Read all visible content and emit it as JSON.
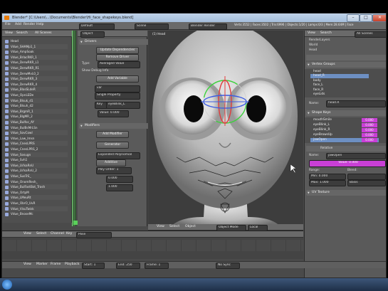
{
  "window": {
    "title": "Blender* [C:\\Users\\...\\Documents\\Blender\\Hi_face_shapekeys.blend]"
  },
  "top_menu": {
    "items": [
      "File",
      "Add",
      "Render",
      "Help"
    ],
    "layout": "Default",
    "scene": "Scene",
    "engine": "Blender Render"
  },
  "info_text": "Verts:3552 | Faces:3502 | Tris:6996 | Objects:1/20 | Lamps:0/3 | Mem:28.64M | Face",
  "outliner": {
    "header": [
      "View",
      "Search",
      "All Scenes"
    ],
    "rows": [
      "Head",
      "Vdue_SHAMp1_1",
      "Vdue_AmpSoak",
      "Vdue_BrlacRKR_1",
      "Vdue_DerwRKR_L1",
      "Vdue_DerwRKR_R1",
      "Vdue_DerwMvL0_2",
      "Vdue_DerwRKR_3",
      "Vdue_DerwRKR_4",
      "Vdue_BlasSLdeR",
      "Vdue_OpnLEDe",
      "Vdue_Blsuk_d1",
      "Vdue_Blsuh_d2",
      "Vdue_BrgmR_1",
      "Vdue_BlgMR_2",
      "Vdue_Bulfoc_AY",
      "Vdue_BulBsMrLSn",
      "Vdue_SovCowl",
      "Vdue_Law_Imsn",
      "Vdue_CnesLPRS",
      "Vdue_CnesLPRS_2",
      "Vdue_Sosugn",
      "Vdue_Svh1",
      "Vdue_LVIsaRnU",
      "Vdue_LVIsaRnU_2",
      "Vdue_SusTrE_",
      "Vdue_OnomResh_",
      "Vdue_BulFastBot_Trash",
      "Vdue_OrtpM",
      "Vdue_LMeuRt",
      "Vdue_ObrO_UvR",
      "Vdue_VisuTwisk",
      "Vdue_BnoseMc"
    ]
  },
  "props": {
    "mode": "Object",
    "drivers_head": "Drivers",
    "update_btn": "Update Dependencies",
    "remove_btn": "Remove Driver",
    "type_label": "Type:",
    "type_value": "Averaged Value",
    "show_debug": "Show Debug Info",
    "add_variable": "Add Variable",
    "var_name": "var",
    "var_type": "Single Property",
    "var_prop": "Key",
    "var_path": "eyeBlink_L",
    "var_value": "Value: 0.000",
    "modifiers_head": "Modifiers",
    "add_modifier": "Add Modifier",
    "generator": "Generator",
    "expanded": "Expanded Polynomial",
    "additive": "Additive",
    "poly_order": "Poly Order: 1",
    "coef0": "0.000",
    "coef1": "1.000"
  },
  "viewport": {
    "header": [
      "View",
      "Select",
      "Object",
      "Object Mode",
      "Local"
    ],
    "status": "(1) Head"
  },
  "right": {
    "header": [
      "View",
      "Search",
      "All Scenes"
    ],
    "tree": [
      "RenderLayers",
      "World",
      "Head"
    ],
    "vgroups_head": "Vertex Groups",
    "vgroups": [
      "head",
      "head_R",
      "body",
      "face_L",
      "face_R",
      "eyeLids"
    ],
    "vgroup_name": "Name:",
    "vgroup_value": "head.R",
    "shape_head": "Shape Keys",
    "shapes": [
      {
        "name": "mouthSmile",
        "value": "0.000"
      },
      {
        "name": "eyeBlink_L",
        "value": "0.000"
      },
      {
        "name": "eyeBlink_R",
        "value": "0.000"
      },
      {
        "name": "eyeBrowsUp",
        "value": "0.000"
      },
      {
        "name": "jawOpen",
        "value": "0.000"
      }
    ],
    "relative": "Relative",
    "shape_name_label": "Name:",
    "shape_name": "jawOpen",
    "shape_value": "Value: 0.000",
    "range_label": "Range:",
    "blend_label": "Blend:",
    "range_min": "Min: 0.000",
    "range_max": "Max: 1.000",
    "vertex_group_ref": "Basis",
    "uv_head": "UV Texture"
  },
  "timeline": {
    "header": [
      "View",
      "Select",
      "Channel",
      "Key",
      "Pose"
    ],
    "footer": [
      "View",
      "Marker",
      "Frame",
      "Playback",
      "Start: 1",
      "End: 250",
      "Frame: 1",
      "No Sync"
    ]
  },
  "colors": {
    "accent": "#c93fd6",
    "selection": "#6d8fc2",
    "green": "#5ad05a"
  }
}
